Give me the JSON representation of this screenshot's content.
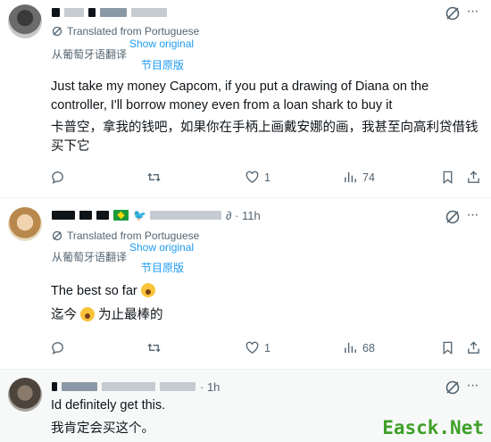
{
  "colors": {
    "accent": "#1d9bf0",
    "muted": "#536471",
    "text": "#0f1419",
    "watermark": "#3fa028"
  },
  "tweets": [
    {
      "avatar_icon": "user-avatar",
      "time": "",
      "translated_label": "Translated from Portuguese",
      "translated_label_zh": "从葡萄牙语翻译",
      "show_original": "Show original",
      "show_original_zh": "节目原版",
      "text_en": "Just take my money Capcom, if you put a drawing of Diana on the controller, I'll borrow money even from a loan shark to buy it",
      "text_zh": "卡普空，拿我的钱吧，如果你在手柄上画戴安娜的画，我甚至向高利贷借钱买下它",
      "reply_count": "",
      "retweet_count": "",
      "like_count": "1",
      "view_count": "74"
    },
    {
      "avatar_icon": "user-avatar",
      "time": "∂ · 11h",
      "translated_label": "Translated from Portuguese",
      "translated_label_zh": "从葡萄牙语翻译",
      "show_original": "Show original",
      "show_original_zh": "节目原版",
      "text_en_prefix": "The best so far",
      "text_zh_prefix": "迄今",
      "text_zh_suffix": "为止最棒的",
      "reply_count": "",
      "retweet_count": "",
      "like_count": "1",
      "view_count": "68"
    },
    {
      "avatar_icon": "user-avatar",
      "time": "· 1h",
      "text_en": "Id definitely get this.",
      "text_zh": "我肯定会买这个。"
    }
  ],
  "watermark": "Easck.Net"
}
